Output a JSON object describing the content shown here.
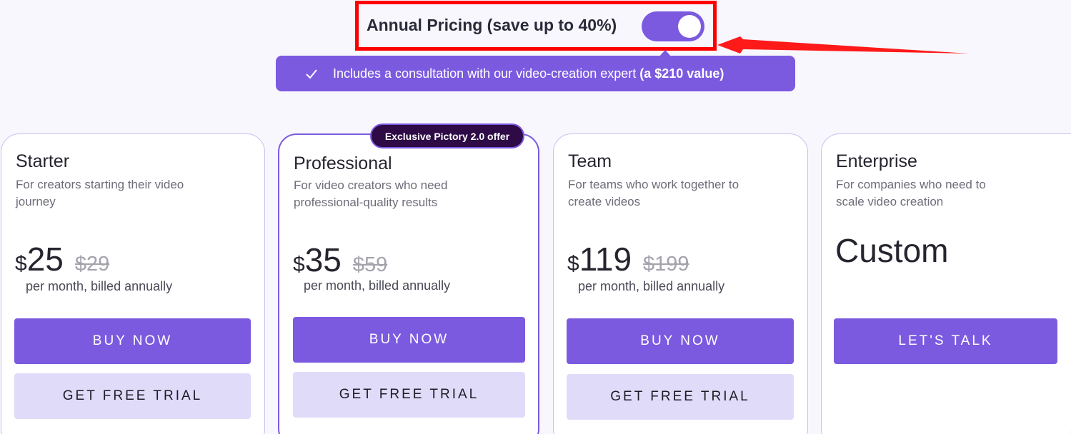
{
  "header": {
    "toggle_label": "Annual Pricing (save up to 40%)",
    "toggle_on": true,
    "banner_text": "Includes a consultation with our video-creation expert",
    "banner_bold": "(a $210 value)"
  },
  "offer_badge": "Exclusive Pictory 2.0 offer",
  "plans": [
    {
      "name": "Starter",
      "description": "For creators starting their video journey",
      "currency": "$",
      "price": "25",
      "old_price": "$29",
      "billing": "per month, billed annually",
      "primary_button": "BUY NOW",
      "secondary_button": "GET FREE TRIAL"
    },
    {
      "name": "Professional",
      "description": "For video creators who need professional-quality results",
      "currency": "$",
      "price": "35",
      "old_price": "$59",
      "billing": "per month, billed annually",
      "primary_button": "BUY NOW",
      "secondary_button": "GET FREE TRIAL"
    },
    {
      "name": "Team",
      "description": "For teams who work together to create videos",
      "currency": "$",
      "price": "119",
      "old_price": "$199",
      "billing": "per month, billed annually",
      "primary_button": "BUY NOW",
      "secondary_button": "GET FREE TRIAL"
    },
    {
      "name": "Enterprise",
      "description": "For companies who need  to scale video creation",
      "custom_price": "Custom",
      "primary_button": "LET'S TALK"
    }
  ],
  "colors": {
    "accent": "#7b5ae0",
    "accent_light": "#e1dbfa",
    "badge_bg": "#2e0a46",
    "annotation_red": "#ff0000"
  },
  "icons": [
    "check-icon",
    "red-annotation-arrow"
  ]
}
